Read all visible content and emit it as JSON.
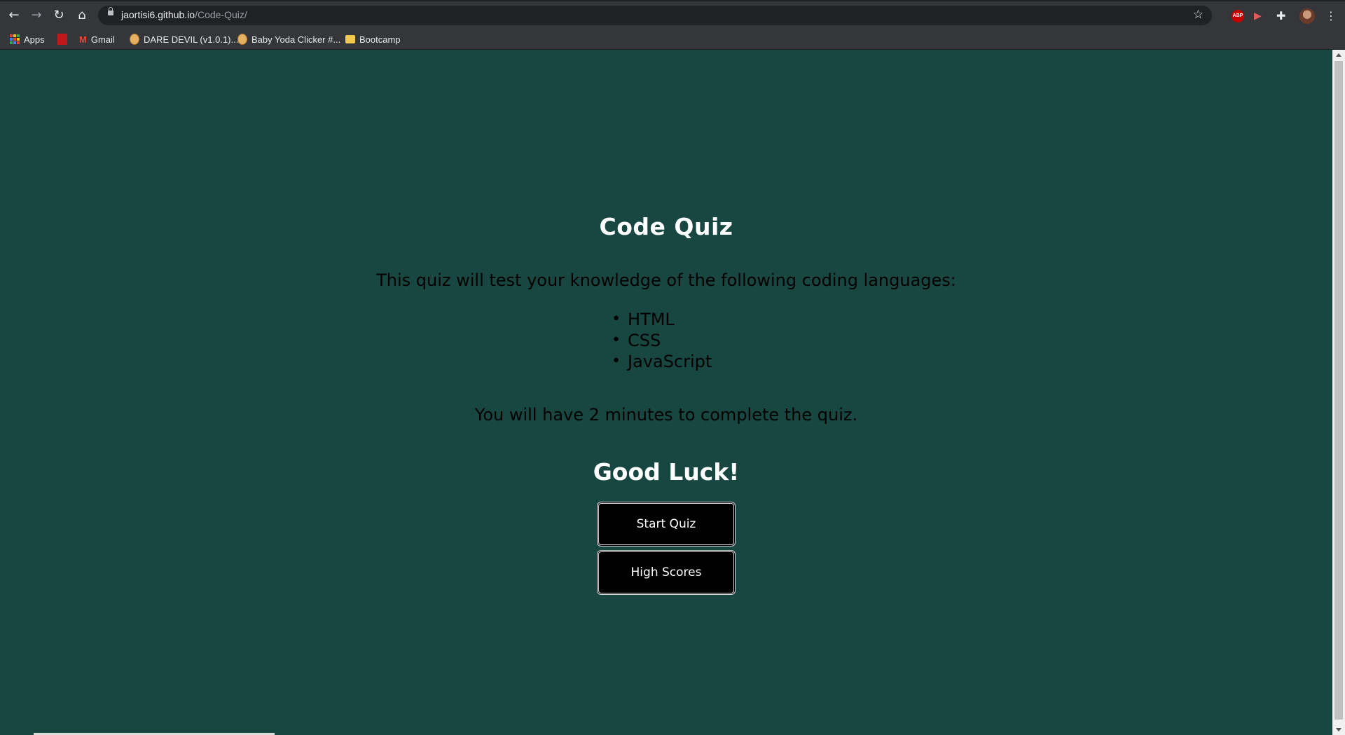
{
  "browser": {
    "url_host": "jaortisi6.github.io",
    "url_path": "/Code-Quiz/",
    "extensions": {
      "abp_label": "ABP"
    },
    "bookmarks": [
      {
        "label": "Apps",
        "icon": "apps-grid-icon"
      },
      {
        "label": "",
        "icon": "red-bookmark-icon"
      },
      {
        "label": "Gmail",
        "icon": "gmail-icon"
      },
      {
        "label": "DARE DEVIL (v1.0.1)...",
        "icon": "cookie-icon"
      },
      {
        "label": "Baby Yoda Clicker #...",
        "icon": "cookie-icon"
      },
      {
        "label": "Bootcamp",
        "icon": "folder-icon"
      }
    ]
  },
  "quiz": {
    "title": "Code Quiz",
    "intro": "This quiz will test your knowledge of the following coding languages:",
    "languages": [
      "HTML",
      "CSS",
      "JavaScript"
    ],
    "duration": "You will have 2 minutes to complete the quiz.",
    "good_luck": "Good Luck!",
    "start_button": "Start Quiz",
    "scores_button": "High Scores"
  },
  "colors": {
    "page_background": "#184640",
    "heading_text": "#ffffff",
    "body_text": "#000000",
    "button_background": "#000000"
  }
}
